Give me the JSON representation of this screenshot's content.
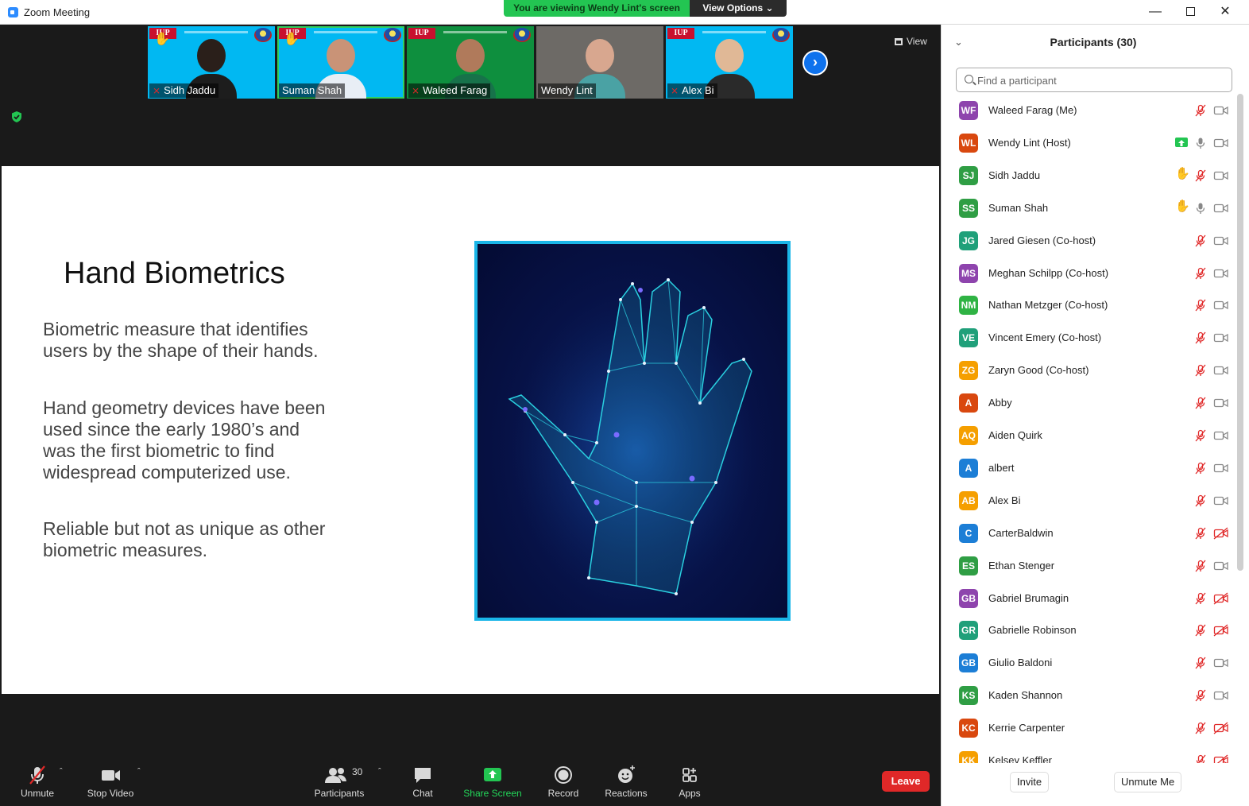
{
  "window": {
    "title": "Zoom Meeting"
  },
  "banner": {
    "viewing": "You are viewing Wendy Lint's screen",
    "view_options": "View Options"
  },
  "meeting": {
    "view_label": "View"
  },
  "thumbnails": [
    {
      "name": "Sidh Jaddu",
      "bg": "blue",
      "muted": true,
      "hand": true,
      "skin": "#2a1f1a",
      "shirt": "#1d1d1d"
    },
    {
      "name": "Suman Shah",
      "bg": "blue",
      "muted": false,
      "hand": true,
      "skin": "#c99377",
      "shirt": "#e8eef5"
    },
    {
      "name": "Waleed Farag",
      "bg": "green",
      "muted": true,
      "hand": false,
      "skin": "#b07a5b",
      "shirt": "#17724a"
    },
    {
      "name": "Wendy Lint",
      "bg": "room",
      "muted": false,
      "hand": false,
      "skin": "#d8a78f",
      "shirt": "#4aa2a4"
    },
    {
      "name": "Alex Bi",
      "bg": "blue",
      "muted": true,
      "hand": false,
      "skin": "#e0b896",
      "shirt": "#2a2a2a"
    }
  ],
  "slide": {
    "title": "Hand Biometrics",
    "paragraphs": [
      "Biometric measure that identifies users by the shape of their hands.",
      "Hand geometry devices have been used since the early 1980’s and was the first biometric to find widespread computerized use.",
      "Reliable but not as unique as other biometric measures."
    ]
  },
  "toolbar": {
    "unmute": "Unmute",
    "stop_video": "Stop Video",
    "participants": "Participants",
    "participants_count": "30",
    "chat": "Chat",
    "share_screen": "Share Screen",
    "record": "Record",
    "reactions": "Reactions",
    "apps": "Apps",
    "leave": "Leave"
  },
  "panel": {
    "title": "Participants (30)",
    "search_placeholder": "Find a participant",
    "invite": "Invite",
    "unmute_me": "Unmute Me",
    "participants": [
      {
        "initials": "WF",
        "name": "Waleed Farag (Me)",
        "color": "#8e44ad",
        "status": "",
        "mic": "off",
        "cam": "on"
      },
      {
        "initials": "WL",
        "name": "Wendy Lint (Host)",
        "color": "#d9480f",
        "status": "sharing",
        "mic": "on",
        "cam": "on"
      },
      {
        "initials": "SJ",
        "name": "Sidh Jaddu",
        "color": "#2f9e44",
        "status": "hand",
        "mic": "off",
        "cam": "on"
      },
      {
        "initials": "SS",
        "name": "Suman Shah",
        "color": "#2f9e44",
        "status": "hand",
        "mic": "on",
        "cam": "on"
      },
      {
        "initials": "JG",
        "name": "Jared Giesen (Co-host)",
        "color": "#20a07a",
        "status": "",
        "mic": "off",
        "cam": "on"
      },
      {
        "initials": "MS",
        "name": "Meghan Schilpp (Co-host)",
        "color": "#8e44ad",
        "status": "",
        "mic": "off",
        "cam": "on"
      },
      {
        "initials": "NM",
        "name": "Nathan Metzger (Co-host)",
        "color": "#2fb344",
        "status": "",
        "mic": "off",
        "cam": "on"
      },
      {
        "initials": "VE",
        "name": "Vincent Emery (Co-host)",
        "color": "#20a07a",
        "status": "",
        "mic": "off",
        "cam": "on"
      },
      {
        "initials": "ZG",
        "name": "Zaryn Good (Co-host)",
        "color": "#f59f00",
        "status": "",
        "mic": "off",
        "cam": "on"
      },
      {
        "initials": "A",
        "name": "Abby",
        "color": "#d9480f",
        "status": "",
        "mic": "off",
        "cam": "on"
      },
      {
        "initials": "AQ",
        "name": "Aiden Quirk",
        "color": "#f59f00",
        "status": "",
        "mic": "off",
        "cam": "on"
      },
      {
        "initials": "A",
        "name": "albert",
        "color": "#1c7ed6",
        "status": "",
        "mic": "off",
        "cam": "on"
      },
      {
        "initials": "AB",
        "name": "Alex Bi",
        "color": "#f59f00",
        "status": "",
        "mic": "off",
        "cam": "on"
      },
      {
        "initials": "C",
        "name": "CarterBaldwin",
        "color": "#1c7ed6",
        "status": "",
        "mic": "off",
        "cam": "off"
      },
      {
        "initials": "ES",
        "name": "Ethan Stenger",
        "color": "#2f9e44",
        "status": "",
        "mic": "off",
        "cam": "on"
      },
      {
        "initials": "GB",
        "name": "Gabriel Brumagin",
        "color": "#8e44ad",
        "status": "",
        "mic": "off",
        "cam": "off"
      },
      {
        "initials": "GR",
        "name": "Gabrielle Robinson",
        "color": "#20a07a",
        "status": "",
        "mic": "off",
        "cam": "off"
      },
      {
        "initials": "GB",
        "name": "Giulio Baldoni",
        "color": "#1c7ed6",
        "status": "",
        "mic": "off",
        "cam": "on"
      },
      {
        "initials": "KS",
        "name": "Kaden Shannon",
        "color": "#2f9e44",
        "status": "",
        "mic": "off",
        "cam": "on"
      },
      {
        "initials": "KC",
        "name": "Kerrie Carpenter",
        "color": "#d9480f",
        "status": "",
        "mic": "off",
        "cam": "off"
      },
      {
        "initials": "KK",
        "name": "Kelsey Keffler",
        "color": "#f59f00",
        "status": "",
        "mic": "off",
        "cam": "off"
      }
    ]
  }
}
